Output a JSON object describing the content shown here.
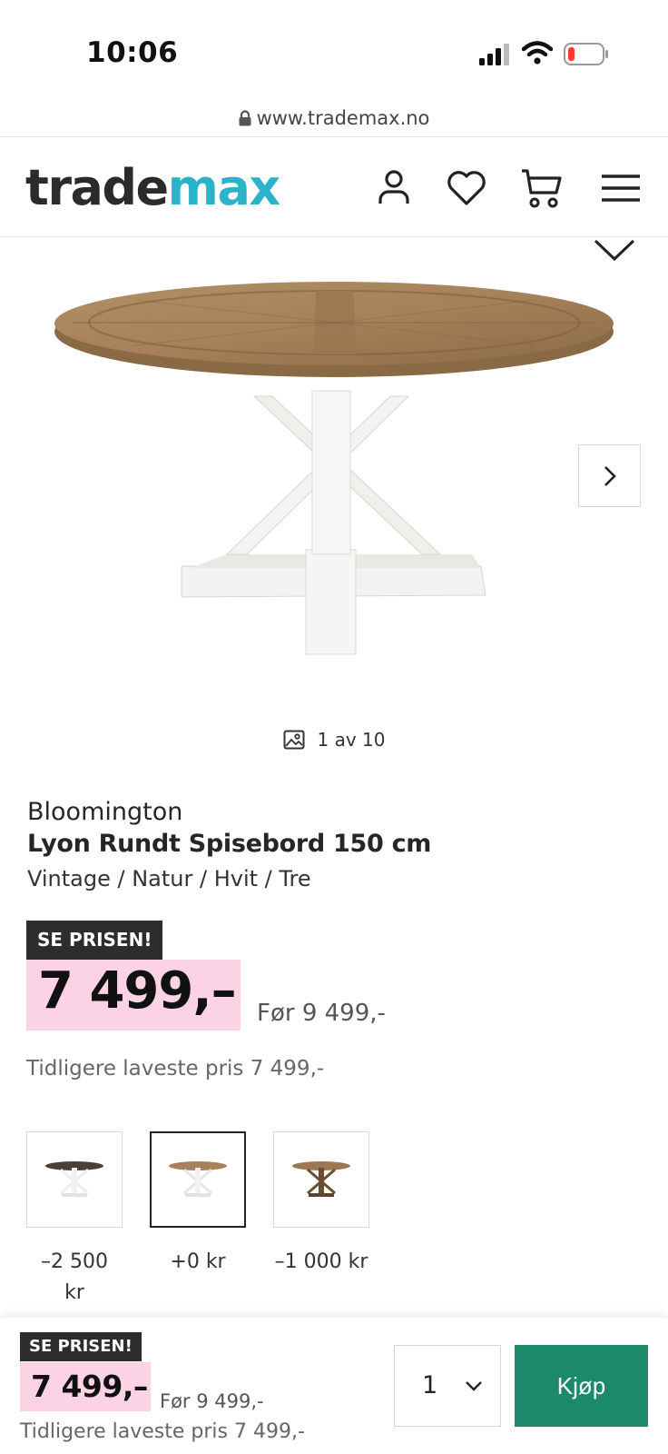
{
  "status_bar": {
    "time": "10:06"
  },
  "browser": {
    "url": "www.trademax.no"
  },
  "header": {
    "logo_part1": "trade",
    "logo_part2": "max",
    "icons": [
      "account-icon",
      "heart-icon",
      "cart-icon",
      "menu-icon"
    ]
  },
  "gallery": {
    "counter": "1 av 10",
    "icons": [
      "chevron-down-icon",
      "chevron-right-icon",
      "image-icon"
    ]
  },
  "product": {
    "brand": "Bloomington",
    "name": "Lyon Rundt Spisebord 150 cm",
    "variant": "Vintage / Natur / Hvit / Tre"
  },
  "pricing": {
    "tag": "SE PRISEN!",
    "price": "7 499,–",
    "before": "Før 9 499,-",
    "lowest": "Tidligere laveste pris 7 499,-"
  },
  "variants": [
    {
      "label": "–2 500 kr",
      "selected": false
    },
    {
      "label": "+0 kr",
      "selected": true
    },
    {
      "label": "–1 000 kr",
      "selected": false
    }
  ],
  "sticky": {
    "tag": "SE PRISEN!",
    "price": "7 499,–",
    "before": "Før 9 499,-",
    "lowest": "Tidligere laveste pris 7 499,-",
    "quantity": "1",
    "buy_label": "Kjøp"
  },
  "colors": {
    "brand_teal": "#2bb3c9",
    "price_highlight": "#fcd3e4",
    "buy_green": "#1b8a6b",
    "tag_dark": "#2d2d2d"
  }
}
